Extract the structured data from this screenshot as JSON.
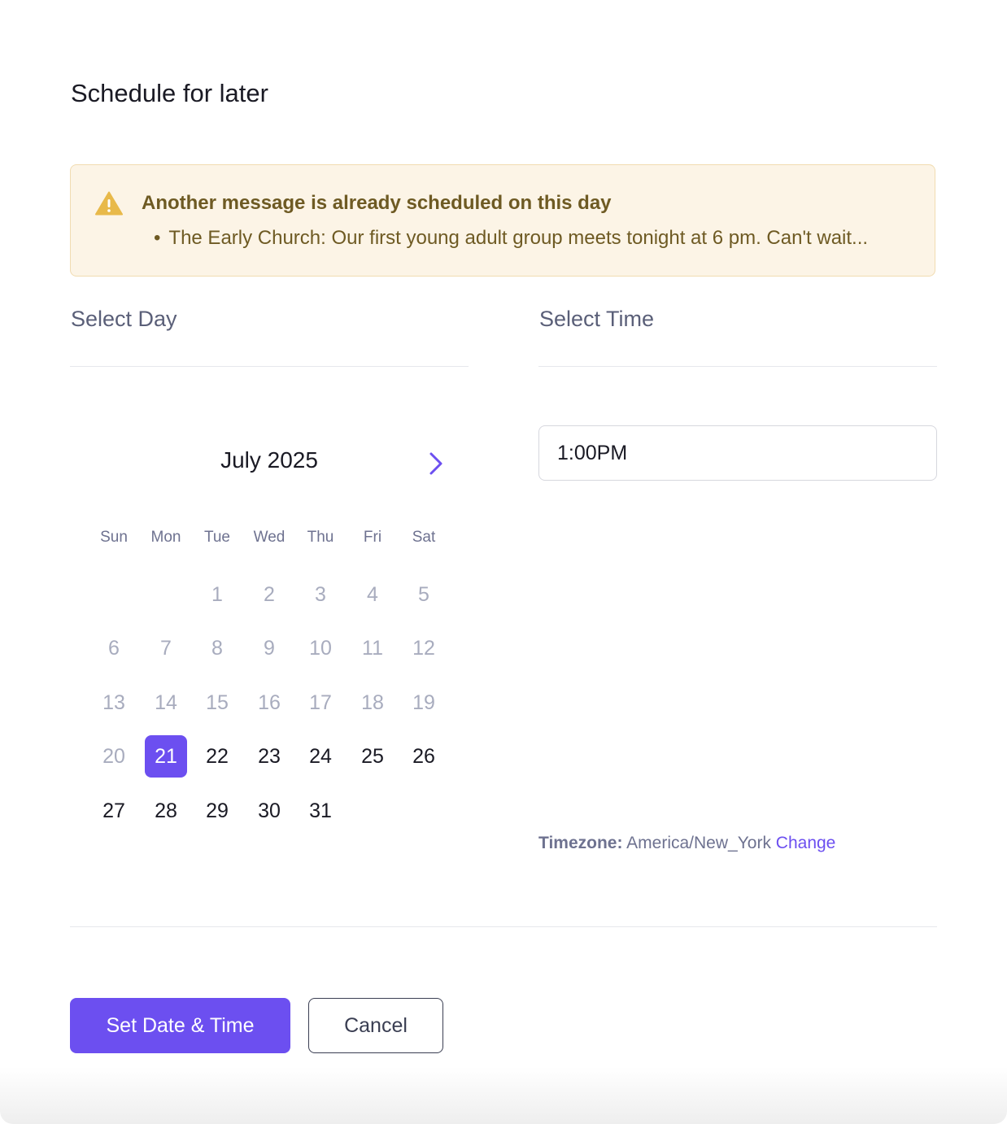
{
  "dialog": {
    "title": "Schedule for later"
  },
  "alert": {
    "icon": "warning-icon",
    "title": "Another message is already scheduled on this day",
    "bullet": "•",
    "items": [
      "The Early Church: Our first young adult group meets tonight at 6 pm. Can't wait..."
    ]
  },
  "day_section": {
    "label": "Select Day",
    "month_label": "July 2025",
    "next_icon": "chevron-right-icon",
    "weekdays": [
      "Sun",
      "Mon",
      "Tue",
      "Wed",
      "Thu",
      "Fri",
      "Sat"
    ],
    "first_weekday_index": 2,
    "days_in_month": 31,
    "selected_day": 21,
    "first_enabled_day": 21
  },
  "time_section": {
    "label": "Select Time",
    "time_value": "1:00PM",
    "timezone_label": "Timezone:",
    "timezone_value": "America/New_York",
    "timezone_change": "Change"
  },
  "actions": {
    "confirm_label": "Set Date & Time",
    "cancel_label": "Cancel"
  },
  "colors": {
    "accent": "#6c4ff0",
    "warning_bg": "#fcf4e6",
    "warning_text": "#6e5a23",
    "warning_icon": "#e8b94a"
  }
}
